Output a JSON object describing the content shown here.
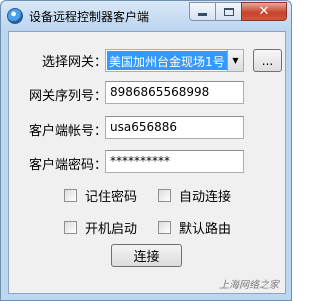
{
  "window": {
    "title": "设备远程控制器客户端",
    "icon": "app-globe-icon",
    "controls": {
      "minimize": "minimize-icon",
      "maximize": "maximize-icon",
      "close": "✕"
    }
  },
  "form": {
    "gateway_select": {
      "label": "选择网关：",
      "value": "美国加州台金现场1号"
    },
    "browse_button": {
      "label": "..."
    },
    "gateway_serial": {
      "label": "网关序列号：",
      "value": "8986865568998"
    },
    "client_account": {
      "label": "客户端帐号：",
      "value": "usa656886"
    },
    "client_password": {
      "label": "客户端密码：",
      "value": "**********"
    },
    "remember_password": {
      "label": "记住密码",
      "checked": false
    },
    "auto_connect": {
      "label": "自动连接",
      "checked": false
    },
    "startup_on_boot": {
      "label": "开机启动",
      "checked": false
    },
    "default_route": {
      "label": "默认路由",
      "checked": false
    },
    "connect_button": {
      "label": "连接"
    }
  },
  "watermark": "上海网络之家"
}
